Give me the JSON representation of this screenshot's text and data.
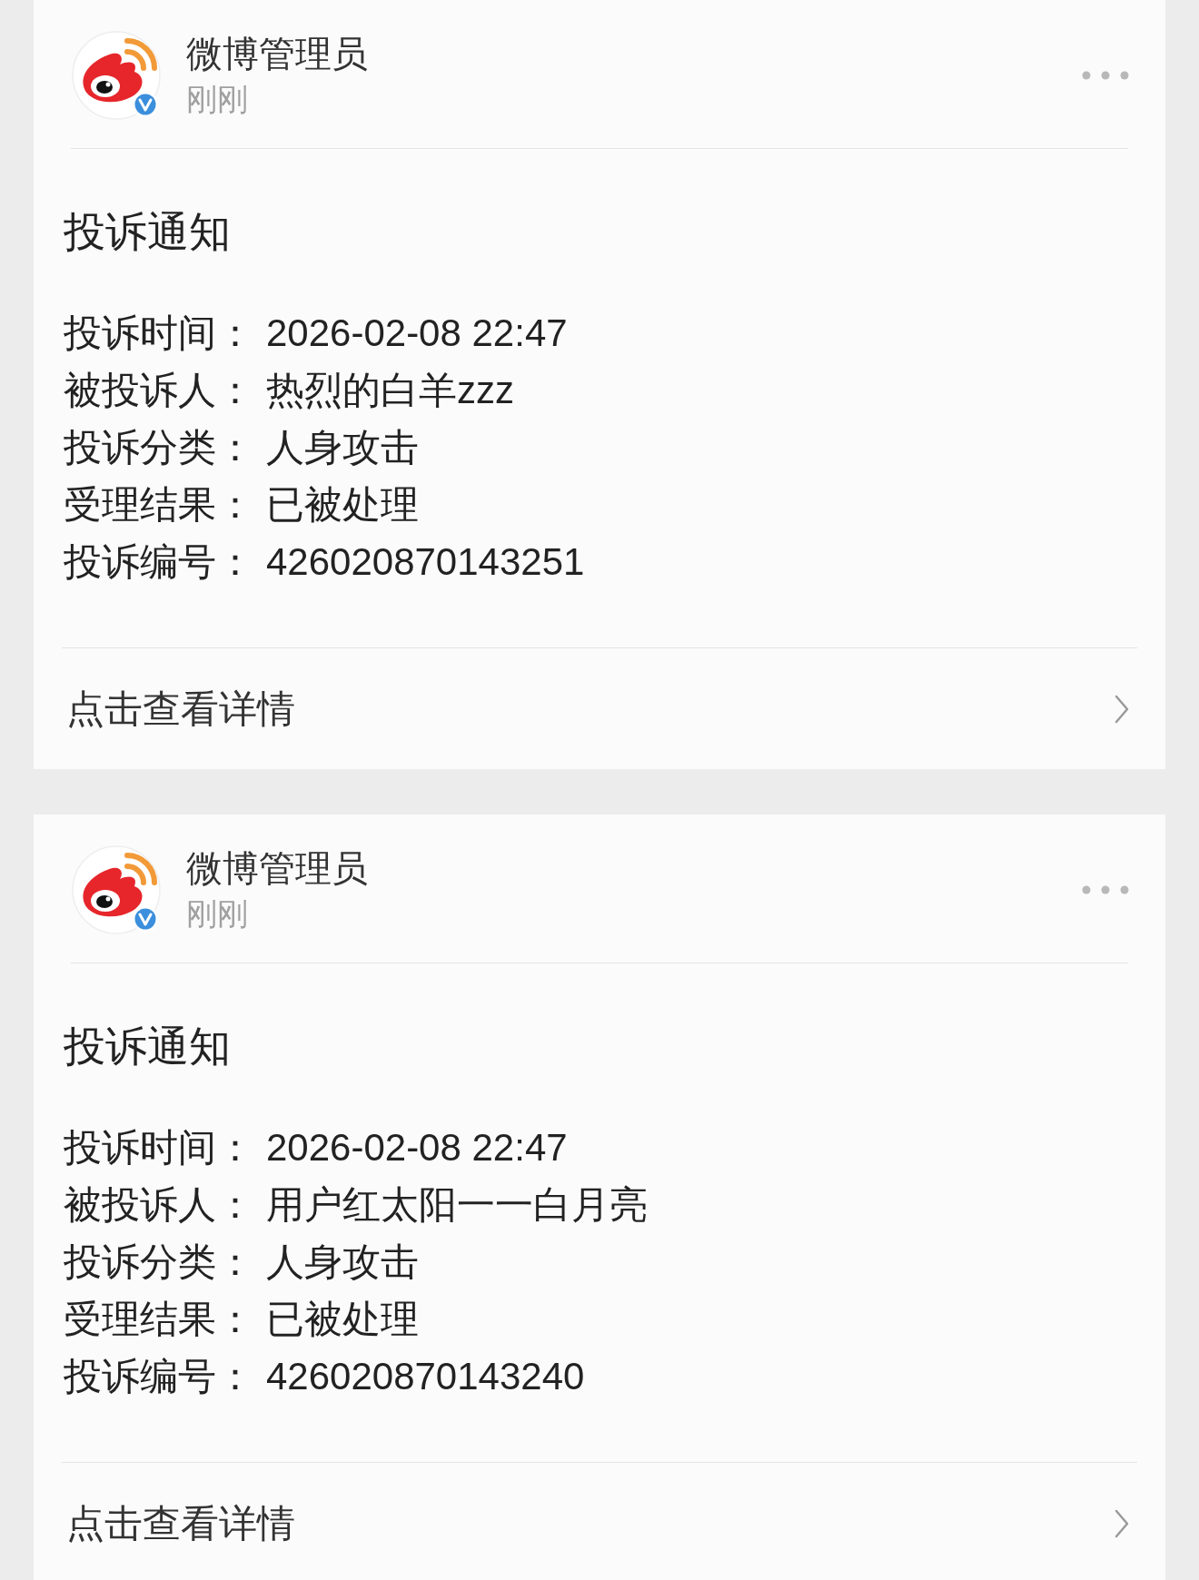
{
  "cards": [
    {
      "sender": {
        "name": "微博管理员",
        "time": "刚刚"
      },
      "title": "投诉通知",
      "fields": [
        {
          "label": "投诉时间：",
          "value": "2026-02-08 22:47"
        },
        {
          "label": "被投诉人：",
          "value": "热烈的白羊zzz"
        },
        {
          "label": "投诉分类：",
          "value": "人身攻击"
        },
        {
          "label": "受理结果：",
          "value": "已被处理"
        },
        {
          "label": "投诉编号：",
          "value": "426020870143251"
        }
      ],
      "link": "点击查看详情"
    },
    {
      "sender": {
        "name": "微博管理员",
        "time": "刚刚"
      },
      "title": "投诉通知",
      "fields": [
        {
          "label": "投诉时间：",
          "value": "2026-02-08 22:47"
        },
        {
          "label": "被投诉人：",
          "value": "用户红太阳一一白月亮"
        },
        {
          "label": "投诉分类：",
          "value": "人身攻击"
        },
        {
          "label": "受理结果：",
          "value": "已被处理"
        },
        {
          "label": "投诉编号：",
          "value": "426020870143240"
        }
      ],
      "link": "点击查看详情"
    }
  ]
}
